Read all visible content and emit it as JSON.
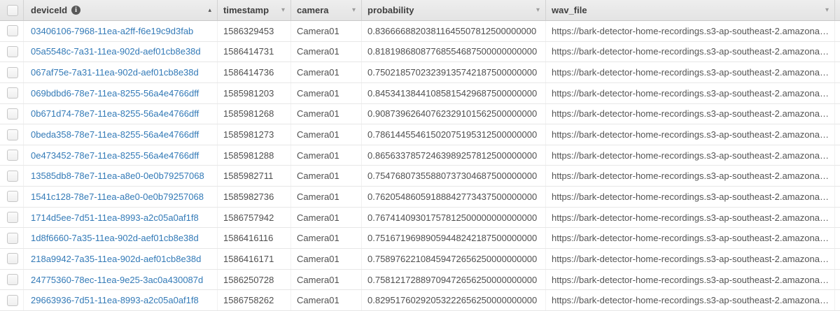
{
  "colors": {
    "link_blue": "#337ab7",
    "header_bg": "#e9e9e9",
    "body_text": "#4f4f4f"
  },
  "icons": {
    "info": "i",
    "sort_ascending": "▴",
    "sort_menu": "▾"
  },
  "table": {
    "columns": [
      {
        "label": "deviceId",
        "sorted": "ascending",
        "has_info_icon": true
      },
      {
        "label": "timestamp"
      },
      {
        "label": "camera"
      },
      {
        "label": "probability"
      },
      {
        "label": "wav_file"
      }
    ],
    "rows": [
      {
        "deviceId": "03406106-7968-11ea-a2ff-f6e19c9d3fab",
        "timestamp": "1586329453",
        "camera": "Camera01",
        "probability": "0.83666688203811645507812500000000",
        "wav_file": "https://bark-detector-home-recordings.s3-ap-southeast-2.amazonaws.com/…"
      },
      {
        "deviceId": "05a5548c-7a31-11ea-902d-aef01cb8e38d",
        "timestamp": "1586414731",
        "camera": "Camera01",
        "probability": "0.81819868087768554687500000000000",
        "wav_file": "https://bark-detector-home-recordings.s3-ap-southeast-2.amazonaws.com/…"
      },
      {
        "deviceId": "067af75e-7a31-11ea-902d-aef01cb8e38d",
        "timestamp": "1586414736",
        "camera": "Camera01",
        "probability": "0.75021857023239135742187500000000",
        "wav_file": "https://bark-detector-home-recordings.s3-ap-southeast-2.amazonaws.com/…"
      },
      {
        "deviceId": "069bdbd6-78e7-11ea-8255-56a4e4766dff",
        "timestamp": "1585981203",
        "camera": "Camera01",
        "probability": "0.84534138441085815429687500000000",
        "wav_file": "https://bark-detector-home-recordings.s3-ap-southeast-2.amazonaws.com/…"
      },
      {
        "deviceId": "0b671d74-78e7-11ea-8255-56a4e4766dff",
        "timestamp": "1585981268",
        "camera": "Camera01",
        "probability": "0.90873962640762329101562500000000",
        "wav_file": "https://bark-detector-home-recordings.s3-ap-southeast-2.amazonaws.com/…"
      },
      {
        "deviceId": "0beda358-78e7-11ea-8255-56a4e4766dff",
        "timestamp": "1585981273",
        "camera": "Camera01",
        "probability": "0.78614455461502075195312500000000",
        "wav_file": "https://bark-detector-home-recordings.s3-ap-southeast-2.amazonaws.com/…"
      },
      {
        "deviceId": "0e473452-78e7-11ea-8255-56a4e4766dff",
        "timestamp": "1585981288",
        "camera": "Camera01",
        "probability": "0.86563378572463989257812500000000",
        "wav_file": "https://bark-detector-home-recordings.s3-ap-southeast-2.amazonaws.com/…"
      },
      {
        "deviceId": "13585db8-78e7-11ea-a8e0-0e0b79257068",
        "timestamp": "1585982711",
        "camera": "Camera01",
        "probability": "0.75476807355880737304687500000000",
        "wav_file": "https://bark-detector-home-recordings.s3-ap-southeast-2.amazonaws.com/…"
      },
      {
        "deviceId": "1541c128-78e7-11ea-a8e0-0e0b79257068",
        "timestamp": "1585982736",
        "camera": "Camera01",
        "probability": "0.76205486059188842773437500000000",
        "wav_file": "https://bark-detector-home-recordings.s3-ap-southeast-2.amazonaws.com/…"
      },
      {
        "deviceId": "1714d5ee-7d51-11ea-8993-a2c05a0af1f8",
        "timestamp": "1586757942",
        "camera": "Camera01",
        "probability": "0.76741409301757812500000000000000",
        "wav_file": "https://bark-detector-home-recordings.s3-ap-southeast-2.amazonaws.com/…"
      },
      {
        "deviceId": "1d8f6660-7a35-11ea-902d-aef01cb8e38d",
        "timestamp": "1586416116",
        "camera": "Camera01",
        "probability": "0.75167196989059448242187500000000",
        "wav_file": "https://bark-detector-home-recordings.s3-ap-southeast-2.amazonaws.com/…"
      },
      {
        "deviceId": "218a9942-7a35-11ea-902d-aef01cb8e38d",
        "timestamp": "1586416171",
        "camera": "Camera01",
        "probability": "0.75897622108459472656250000000000",
        "wav_file": "https://bark-detector-home-recordings.s3-ap-southeast-2.amazonaws.com/…"
      },
      {
        "deviceId": "24775360-78ec-11ea-9e25-3ac0a430087d",
        "timestamp": "1586250728",
        "camera": "Camera01",
        "probability": "0.75812172889709472656250000000000",
        "wav_file": "https://bark-detector-home-recordings.s3-ap-southeast-2.amazonaws.com/…"
      },
      {
        "deviceId": "29663936-7d51-11ea-8993-a2c05a0af1f8",
        "timestamp": "1586758262",
        "camera": "Camera01",
        "probability": "0.82951760292053222656250000000000",
        "wav_file": "https://bark-detector-home-recordings.s3-ap-southeast-2.amazonaws.com/…"
      }
    ]
  }
}
